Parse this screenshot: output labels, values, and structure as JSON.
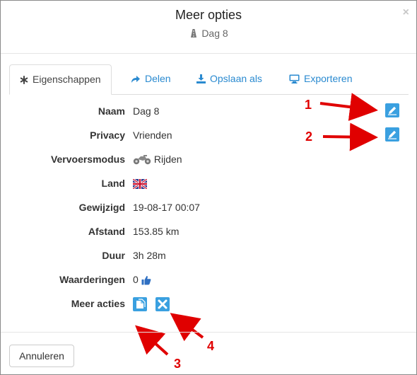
{
  "header": {
    "title": "Meer opties",
    "subtitle": "Dag 8",
    "subtitle_icon": "road-icon",
    "close": "×"
  },
  "tabs": [
    {
      "label": "Eigenschappen",
      "icon": "asterisk-icon",
      "active": true
    },
    {
      "label": "Delen",
      "icon": "share-icon",
      "active": false
    },
    {
      "label": "Opslaan als",
      "icon": "download-icon",
      "active": false
    },
    {
      "label": "Exporteren",
      "icon": "monitor-icon",
      "active": false
    }
  ],
  "properties": {
    "naam": {
      "label": "Naam",
      "value": "Dag 8"
    },
    "privacy": {
      "label": "Privacy",
      "value": "Vrienden"
    },
    "vervoersmodus": {
      "label": "Vervoersmodus",
      "value": "Rijden",
      "icon": "motorcycle-icon"
    },
    "land": {
      "label": "Land",
      "icon": "uk-flag-icon"
    },
    "gewijzigd": {
      "label": "Gewijzigd",
      "value": "19-08-17 00:07"
    },
    "afstand": {
      "label": "Afstand",
      "value": "153.85 km"
    },
    "duur": {
      "label": "Duur",
      "value": "3h 28m"
    },
    "waarderingen": {
      "label": "Waarderingen",
      "value": "0",
      "icon": "thumbs-up-icon"
    },
    "meer_acties": {
      "label": "Meer acties"
    }
  },
  "annotations": {
    "a1": "1",
    "a2": "2",
    "a3": "3",
    "a4": "4",
    "color": "#e00000"
  },
  "footer": {
    "cancel_label": "Annuleren"
  },
  "colors": {
    "accent": "#2a8ad0",
    "edit_button": "#3aa0e0"
  }
}
